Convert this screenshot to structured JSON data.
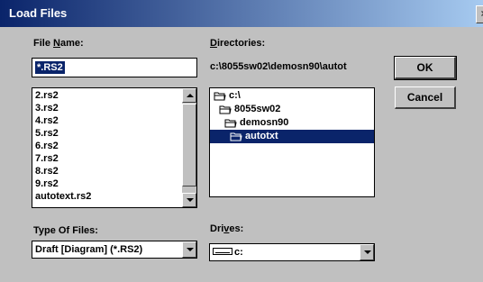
{
  "window": {
    "title": "Load Files",
    "close_glyph": "×"
  },
  "file_name": {
    "label_prefix": "File ",
    "label_hotkey": "N",
    "label_suffix": "ame:",
    "value": "*.RS2"
  },
  "files": [
    "2.rs2",
    "3.rs2",
    "4.rs2",
    "5.rs2",
    "6.rs2",
    "7.rs2",
    "8.rs2",
    "9.rs2",
    "autotext.rs2"
  ],
  "directories": {
    "label_hotkey": "D",
    "label_suffix": "irectories:",
    "path": "c:\\8055sw02\\demosn90\\autot",
    "tree": [
      {
        "name": "c:\\",
        "icon": "open-folder-icon"
      },
      {
        "name": "8055sw02",
        "icon": "open-folder-icon"
      },
      {
        "name": "demosn90",
        "icon": "open-folder-icon"
      },
      {
        "name": "autotxt",
        "icon": "open-folder-icon",
        "selected": true
      }
    ]
  },
  "buttons": {
    "ok": "OK",
    "cancel": "Cancel"
  },
  "type_of_files": {
    "label": "Type Of Files:",
    "value": "Draft [Diagram]  (*.RS2)"
  },
  "drives": {
    "label_prefix": "Dri",
    "label_hotkey": "v",
    "label_suffix": "es:",
    "value": "c:",
    "icon": "drive-icon"
  },
  "colors": {
    "selection": "#0a246a",
    "face": "#c0c0c0"
  }
}
